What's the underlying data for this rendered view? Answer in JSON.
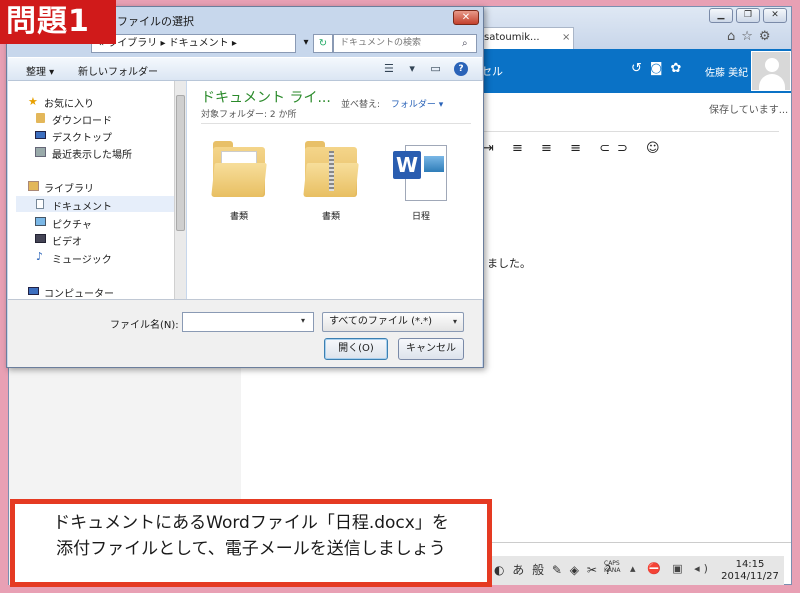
{
  "browser": {
    "tab_label": "satoumik...",
    "tab_close": "×",
    "win_buttons": [
      "▁",
      "❐",
      "✕"
    ],
    "nav_icons": "⌂☆⚙",
    "appbar_selection": "セル",
    "appbar_icons": "↺◙✿",
    "user_name": "佐藤 美紀",
    "saving_status": "保存しています...",
    "format_toolbar": "⇥ ≡ ≡ ≡ ⊂⊃ ☺",
    "body_text": "ました。"
  },
  "taskbar": {
    "tray_icons": "◐ あ 般 ✎ ◈ ✂ ?",
    "caps": "CAPS",
    "kana": "KANA",
    "tray_icons2": "▴ ⛔ ▣ ◂)",
    "time": "14:15",
    "date": "2014/11/27"
  },
  "dialog": {
    "title": "ファイルの選択",
    "close": "✕",
    "address": "« ライブラリ ▸ ドキュメント ▸",
    "address_go": "▾",
    "refresh": "↻",
    "search_placeholder": "ドキュメントの検索",
    "search_icon": "⌕",
    "organize": "整理 ▾",
    "new_folder": "新しいフォルダー",
    "view_icons": "☰ ▾ ▭",
    "help": "?",
    "nav": {
      "favorites": "お気に入り",
      "downloads": "ダウンロード",
      "desktop": "デスクトップ",
      "recent": "最近表示した場所",
      "libraries": "ライブラリ",
      "documents": "ドキュメント",
      "pictures": "ピクチャ",
      "videos": "ビデオ",
      "music": "ミュージック",
      "computer": "コンピューター"
    },
    "library_title": "ドキュメント ライ...",
    "library_sub": "対象フォルダー: 2 か所",
    "sort_label": "並べ替え:",
    "sort_value": "フォルダー ▾",
    "files": [
      {
        "name": "書類"
      },
      {
        "name": "書類"
      },
      {
        "name": "日程"
      }
    ],
    "word_letter": "W",
    "filename_label": "ファイル名(N):",
    "filename_value": "",
    "filename_dd": "▾",
    "filter_value": "すべてのファイル (*.*)",
    "filter_dd": "▾",
    "open_button": "開く(O)",
    "cancel_button": "キャンセル"
  },
  "badge": "問題1",
  "instruction": {
    "line1": "ドキュメントにあるWordファイル「日程.docx」を",
    "line2": "添付ファイルとして、電子メールを送信しましょう"
  },
  "colors": {
    "background": "#e8a0b4",
    "appbar": "#0a72c6",
    "badge": "#d01a1a",
    "instruction_border": "#e53a22",
    "library_title": "#2a8a2a"
  }
}
